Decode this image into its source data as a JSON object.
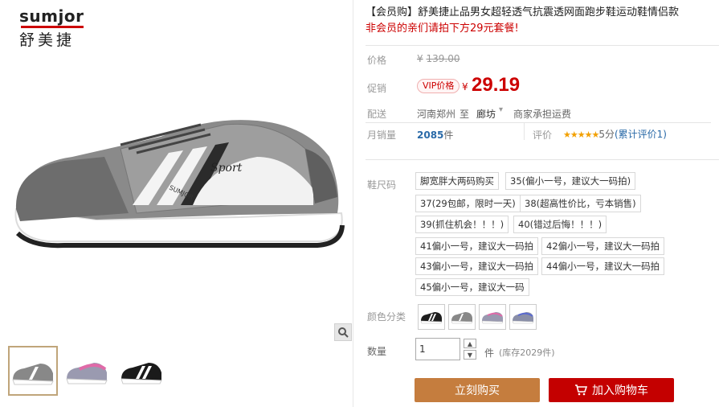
{
  "brand": {
    "en": "sumjor",
    "cn": "舒美捷"
  },
  "title": "【会员购】舒美捷止品男女超轻透气抗震透网面跑步鞋运动鞋情侣款",
  "subtitle": "非会员的亲们请拍下方29元套餐!",
  "price": {
    "label": "价格",
    "currency": "¥",
    "original": "139.00"
  },
  "promo": {
    "label": "促销",
    "badge": "VIP价格",
    "currency": "¥",
    "value": "29.19"
  },
  "delivery": {
    "label": "配送",
    "from": "河南郑州",
    "to_word": "至",
    "to": "廊坊",
    "fee": "商家承担运费"
  },
  "sales": {
    "label": "月销量",
    "count": "2085",
    "unit": "件",
    "rating_label": "评价",
    "stars": "★★★★★",
    "score": "5分",
    "rating_note": "(累计评价1)"
  },
  "size": {
    "label": "鞋尺码",
    "options": [
      "脚宽胖大两码购买",
      "35(偏小一号，建议大一码拍)",
      "37(29包邮，限时一天)",
      "38(超高性价比，亏本销售)",
      "39(抓住机会！！！)",
      "40(错过后悔！！！)",
      "41偏小一号，建议大一码拍",
      "42偏小一号，建议大一码拍",
      "43偏小一号，建议大一码拍",
      "44偏小一号，建议大一码拍",
      "45偏小一号，建议大一码"
    ]
  },
  "color": {
    "label": "颜色分类",
    "swatches": [
      "black-white",
      "grey-white",
      "grey-pink",
      "grey-blue"
    ]
  },
  "quantity": {
    "label": "数量",
    "value": "1",
    "unit": "件",
    "stock": "(库存2029件)"
  },
  "actions": {
    "buy": "立刻购买",
    "cart": "加入购物车"
  },
  "icons": {
    "zoom": "magnifier-icon",
    "cart": "cart-icon",
    "dropdown": "chevron-down-icon"
  },
  "colors": {
    "accent": "#c40000",
    "buy": "#c57d3e",
    "cart": "#c40000",
    "star": "#f2a000"
  }
}
